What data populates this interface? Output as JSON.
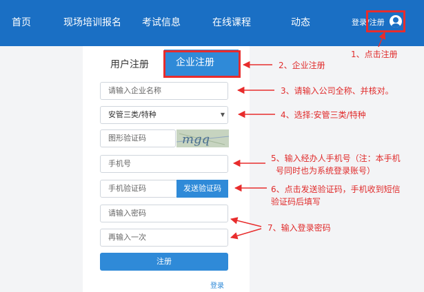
{
  "nav": {
    "items": [
      "首页",
      "现场培训报名",
      "考试信息",
      "在线课程",
      "动态"
    ],
    "login": "登录/注册"
  },
  "tabs": {
    "user": "用户注册",
    "company": "企业注册"
  },
  "form": {
    "company_name_placeholder": "请输入企业名称",
    "category_value": "安管三类/特种",
    "captcha_placeholder": "图形验证码",
    "captcha_text": "mgq",
    "phone_placeholder": "手机号",
    "sms_code_placeholder": "手机验证码",
    "send_code_label": "发送验证码",
    "password_placeholder": "请输入密码",
    "password_confirm_placeholder": "再输入一次",
    "submit_label": "注册",
    "login_link": "登录"
  },
  "annotations": {
    "step1": "1、点击注册",
    "step2": "2、企业注册",
    "step3": "3、请输入公司全称、并核对。",
    "step4": "4、选择:安管三类/特种",
    "step5_line1": "5、输入经办人手机号（注：本手机",
    "step5_line2": "号同时也为系统登录账号）",
    "step6_line1": "6、点击发送验证码，手机收到短信",
    "step6_line2": "验证码后填写",
    "step7": "7、输入登录密码"
  },
  "colors": {
    "nav": "#1a6fc4",
    "accent": "#2f8ad8",
    "annotation": "#e02b2b"
  }
}
